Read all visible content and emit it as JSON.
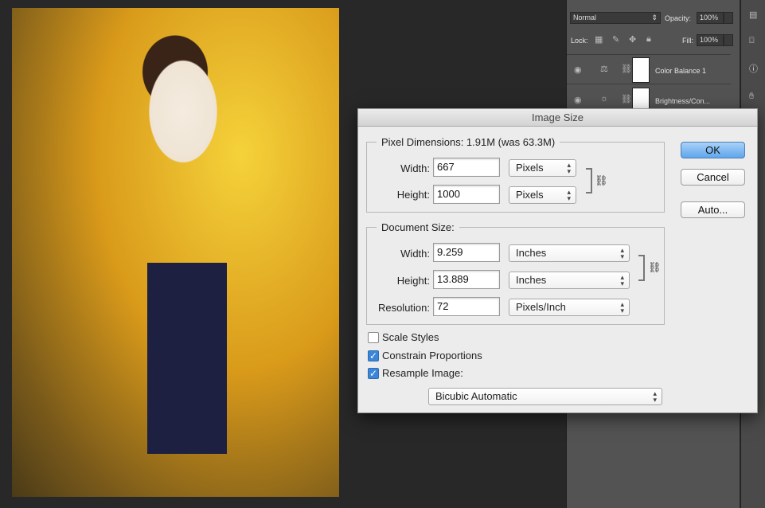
{
  "panel": {
    "blend_mode": "Normal",
    "opacity_label": "Opacity:",
    "opacity": "100%",
    "lock_label": "Lock:",
    "fill_label": "Fill:",
    "fill": "100%",
    "layers": [
      {
        "name": "Color Balance 1",
        "icon": "balance-scale-icon"
      },
      {
        "name": "Brightness/Con...",
        "icon": "sun-icon"
      }
    ]
  },
  "dialog": {
    "title": "Image Size",
    "pixel_dimensions": {
      "legend": "Pixel Dimensions:  1.91M (was 63.3M)",
      "width_label": "Width:",
      "width": "667",
      "width_unit": "Pixels",
      "height_label": "Height:",
      "height": "1000",
      "height_unit": "Pixels"
    },
    "document_size": {
      "legend": "Document Size:",
      "width_label": "Width:",
      "width": "9.259",
      "width_unit": "Inches",
      "height_label": "Height:",
      "height": "13.889",
      "height_unit": "Inches",
      "resolution_label": "Resolution:",
      "resolution": "72",
      "resolution_unit": "Pixels/Inch"
    },
    "options": {
      "scale_styles": {
        "label": "Scale Styles",
        "checked": false
      },
      "constrain": {
        "label": "Constrain Proportions",
        "checked": true
      },
      "resample": {
        "label": "Resample Image:",
        "checked": true
      },
      "method": "Bicubic Automatic"
    },
    "buttons": {
      "ok": "OK",
      "cancel": "Cancel",
      "auto": "Auto..."
    }
  }
}
